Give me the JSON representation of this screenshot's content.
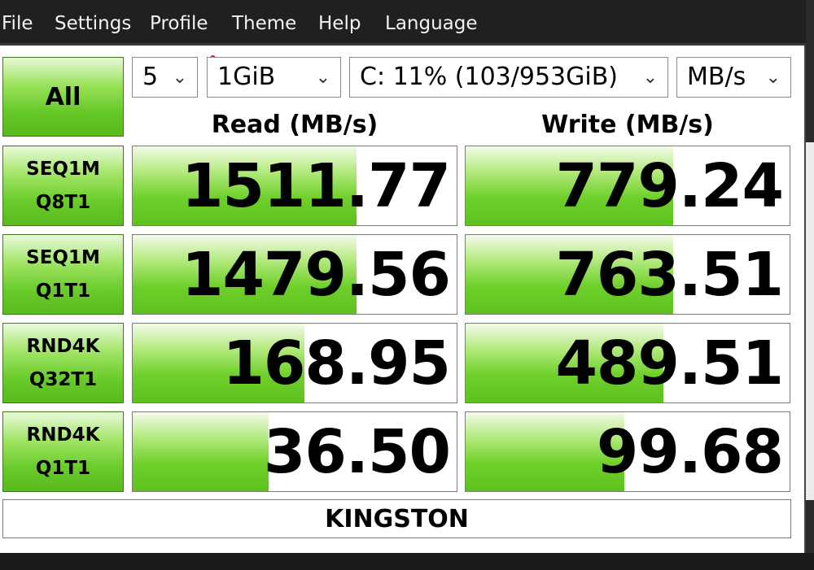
{
  "menu": [
    "File",
    "Settings",
    "Profile",
    "Theme",
    "Help",
    "Language"
  ],
  "all_button": "All",
  "controls": {
    "count": "5",
    "size": "1GiB",
    "drive": "C: 11% (103/953GiB)",
    "unit": "MB/s"
  },
  "headers": {
    "read": "Read (MB/s)",
    "write": "Write (MB/s)"
  },
  "tests": [
    {
      "line1": "SEQ1M",
      "line2": "Q8T1",
      "read": "1511.77",
      "write": "779.24",
      "read_level": 0.69,
      "write_level": 0.64
    },
    {
      "line1": "SEQ1M",
      "line2": "Q1T1",
      "read": "1479.56",
      "write": "763.51",
      "read_level": 0.69,
      "write_level": 0.64
    },
    {
      "line1": "RND4K",
      "line2": "Q32T1",
      "read": "168.95",
      "write": "489.51",
      "read_level": 0.53,
      "write_level": 0.61
    },
    {
      "line1": "RND4K",
      "line2": "Q1T1",
      "read": "36.50",
      "write": "99.68",
      "read_level": 0.42,
      "write_level": 0.49
    }
  ],
  "drive_name": "KINGSTON",
  "colors": {
    "accent_green": "#66c827",
    "menubar": "#202020"
  }
}
